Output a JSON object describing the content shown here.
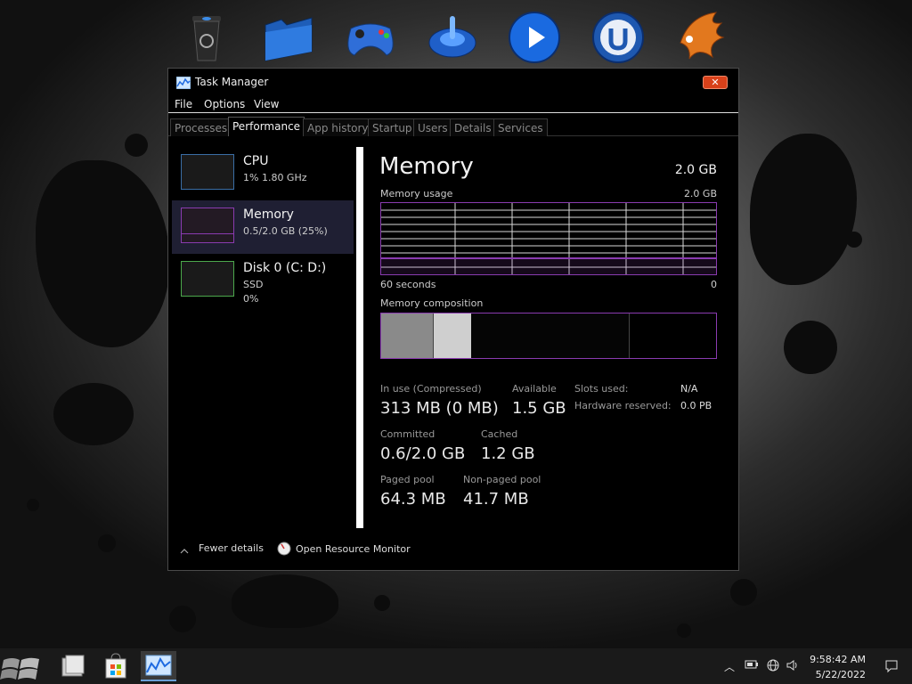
{
  "window": {
    "title": "Task Manager",
    "close_glyph": "✕"
  },
  "menu": [
    "File",
    "Options",
    "View"
  ],
  "tabs": [
    "Processes",
    "Performance",
    "App history",
    "Startup",
    "Users",
    "Details",
    "Services"
  ],
  "active_tab": "Performance",
  "sidebar": [
    {
      "title": "CPU",
      "sub1": "1% 1.80 GHz",
      "sub2": ""
    },
    {
      "title": "Memory",
      "sub1": "0.5/2.0 GB (25%)",
      "sub2": ""
    },
    {
      "title": "Disk 0 (C: D:)",
      "sub1": "SSD",
      "sub2": "0%"
    }
  ],
  "main": {
    "title": "Memory",
    "total": "2.0 GB",
    "usage_label": "Memory usage",
    "usage_max": "2.0 GB",
    "axis_left": "60 seconds",
    "axis_right": "0",
    "composition_label": "Memory composition",
    "in_use_label": "In use (Compressed)",
    "in_use_value": "313 MB (0 MB)",
    "available_label": "Available",
    "available_value": "1.5 GB",
    "committed_label": "Committed",
    "committed_value": "0.6/2.0 GB",
    "cached_label": "Cached",
    "cached_value": "1.2 GB",
    "paged_label": "Paged pool",
    "paged_value": "64.3 MB",
    "nonpaged_label": "Non-paged pool",
    "nonpaged_value": "41.7 MB",
    "slots_label": "Slots used:",
    "slots_value": "N/A",
    "hw_reserved_label": "Hardware reserved:",
    "hw_reserved_value": "0.0 PB"
  },
  "footer": {
    "fewer_details": "Fewer details",
    "resource_monitor": "Open Resource Monitor"
  },
  "taskbar": {
    "time": "9:58:42 AM",
    "date": "5/22/2022"
  },
  "colors": {
    "memory_accent": "#8a3bb0",
    "cpu_accent": "#3a6ea5",
    "disk_accent": "#4ca84c"
  }
}
